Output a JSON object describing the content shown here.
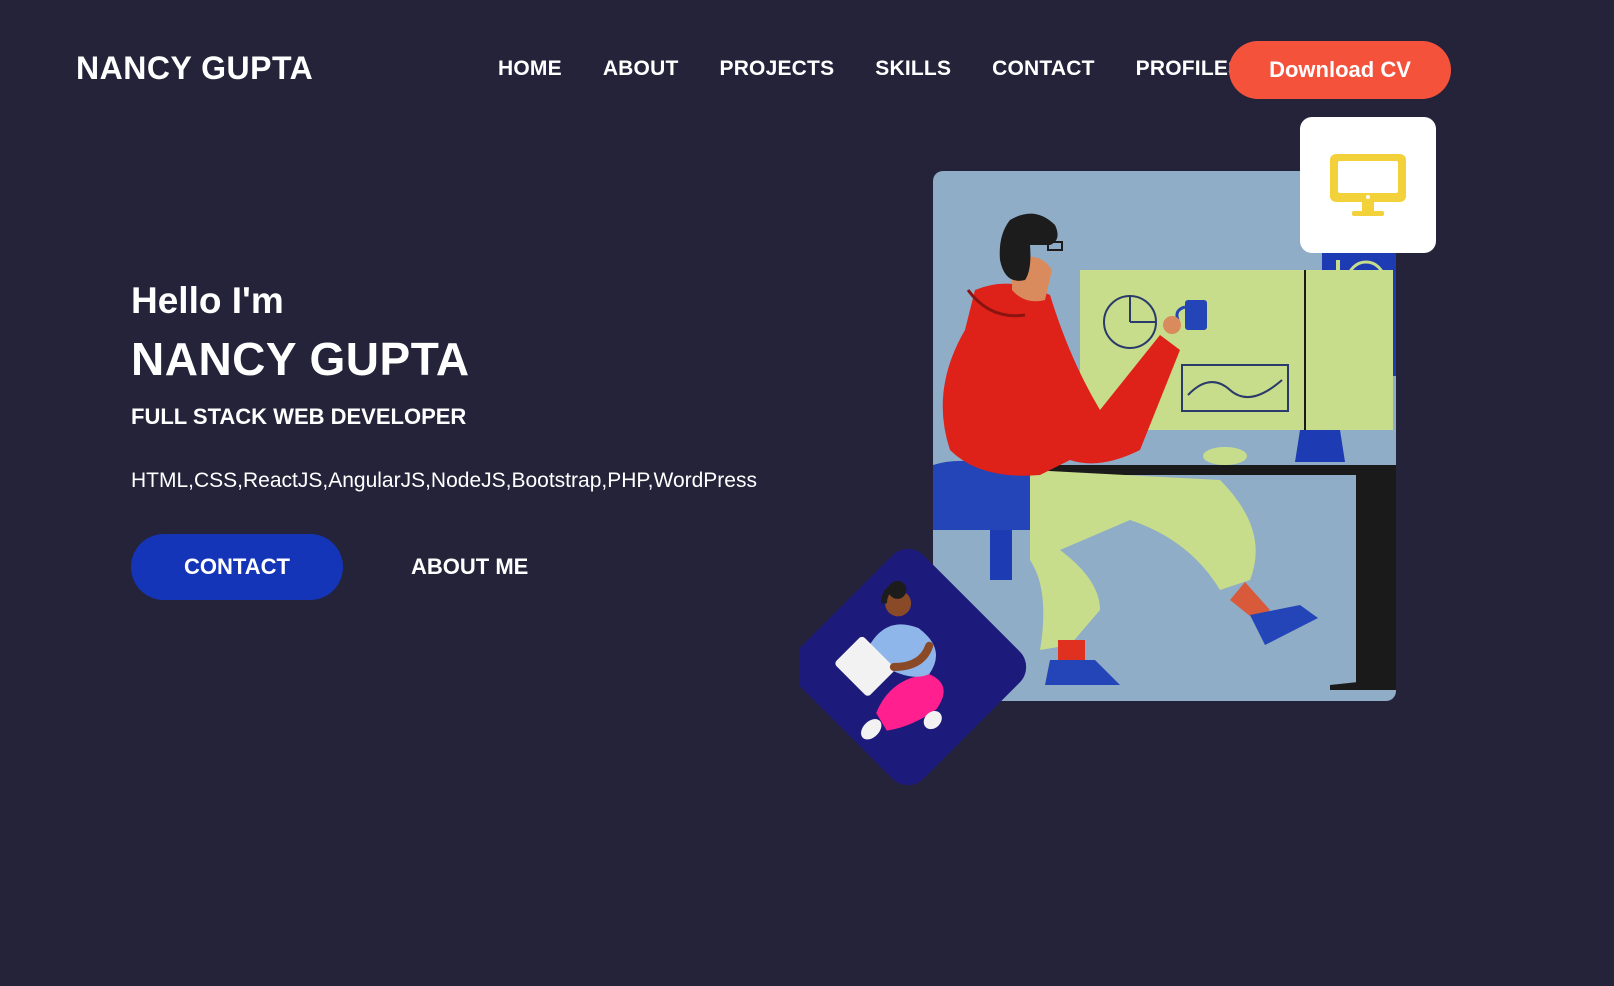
{
  "header": {
    "logo": "NANCY GUPTA",
    "nav": [
      {
        "label": "HOME"
      },
      {
        "label": "ABOUT"
      },
      {
        "label": "PROJECTS"
      },
      {
        "label": "SKILLS"
      },
      {
        "label": "CONTACT"
      },
      {
        "label": "PROFILES"
      }
    ],
    "cv_button": "Download CV"
  },
  "hero": {
    "greeting": "Hello I'm",
    "name": "NANCY GUPTA",
    "role": "FULL STACK WEB DEVELOPER",
    "skills": "HTML,CSS,ReactJS,AngularJS,NodeJS,Bootstrap,PHP,WordPress",
    "contact_button": "CONTACT",
    "about_link": "ABOUT ME"
  },
  "illustration": {
    "icon": "desktop-monitor-icon",
    "colors": {
      "background": "#25233a",
      "accent_orange": "#f5523c",
      "accent_blue": "#1435b8",
      "card_bg": "#8fadc7",
      "monitor_icon": "#f2d13a"
    }
  }
}
